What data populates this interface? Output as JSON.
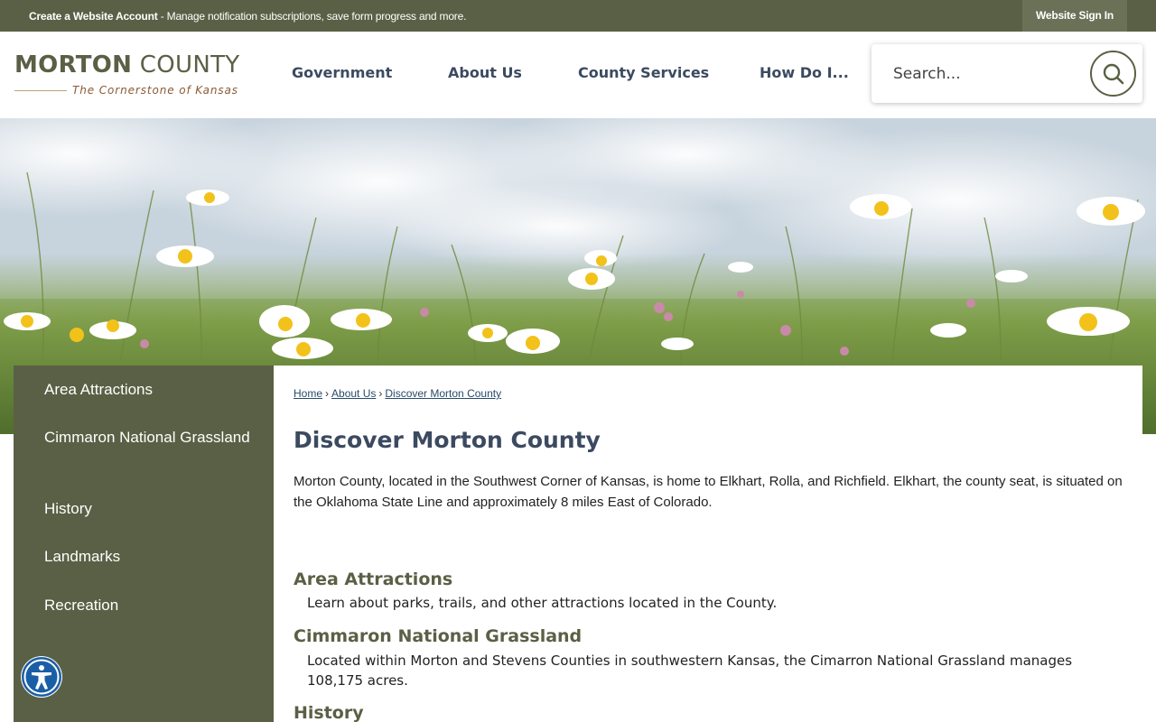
{
  "topbar": {
    "message_bold": "Create a Website Account",
    "message_rest": " - Manage notification subscriptions, save form progress and more.",
    "sign_in": "Website Sign In"
  },
  "logo": {
    "name_bold": "MORTON",
    "name_rest": " COUNTY",
    "tagline": "The Cornerstone of Kansas"
  },
  "nav": {
    "items": [
      {
        "label": "Government"
      },
      {
        "label": "About Us"
      },
      {
        "label": "County Services"
      },
      {
        "label": "How Do I..."
      }
    ]
  },
  "search": {
    "placeholder": "Search..."
  },
  "sidebar": {
    "items": [
      {
        "label": "Area Attractions"
      },
      {
        "label": "Cimmaron National Grassland"
      },
      {
        "label": "History"
      },
      {
        "label": "Landmarks"
      },
      {
        "label": "Recreation"
      }
    ]
  },
  "breadcrumb": {
    "items": [
      "Home",
      "About Us",
      "Discover Morton County"
    ],
    "separator": "›"
  },
  "main": {
    "title": "Discover Morton County",
    "intro": "Morton County, located in the Southwest Corner of Kansas, is home to Elkhart, Rolla, and Richfield. Elkhart, the county seat, is situated on the Oklahoma State Line and approximately 8 miles East of Colorado.",
    "sections": [
      {
        "title": "Area Attractions",
        "description": "Learn about parks, trails, and other attractions located in the County."
      },
      {
        "title": "Cimmaron National Grassland",
        "description": "Located within Morton and Stevens Counties in southwestern Kansas, the Cimarron National Grassland manages 108,175 acres."
      },
      {
        "title": "History",
        "description": ""
      }
    ]
  },
  "colors": {
    "olive": "#5a6045",
    "navy_text": "#3b4a60",
    "tagline_brown": "#8a5a37",
    "accessibility_blue": "#1a5fa6"
  },
  "icons": {
    "search": "search-icon",
    "accessibility": "accessibility-icon"
  }
}
